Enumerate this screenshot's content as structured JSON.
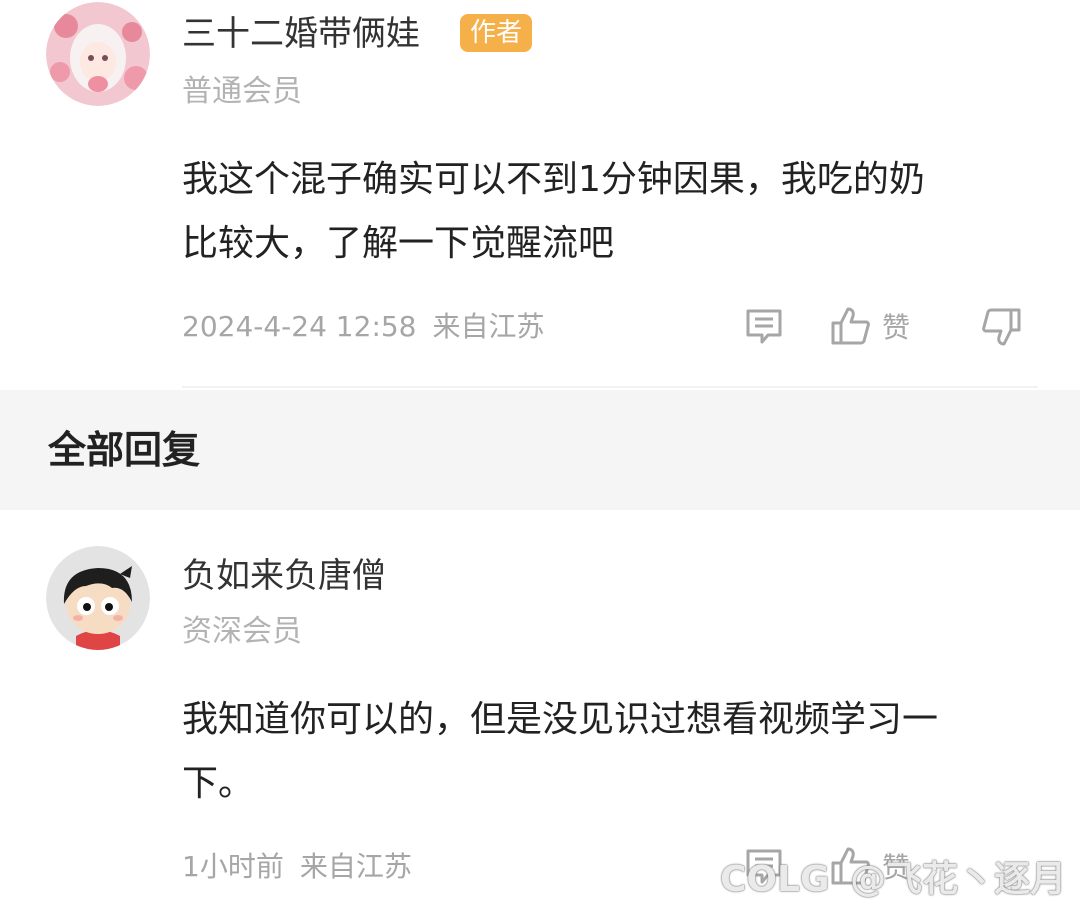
{
  "post": {
    "username": "三十二婚带俩娃",
    "badge": "作者",
    "member_level": "普通会员",
    "content_line1": "我这个混子确实可以不到1分钟因果，我吃的奶",
    "content_line2": "比较大，了解一下觉醒流吧",
    "timestamp": "2024-4-24 12:58",
    "location": "来自江苏",
    "like_label": "赞"
  },
  "section": {
    "title": "全部回复"
  },
  "reply": {
    "username": "负如来负唐僧",
    "member_level": "资深会员",
    "content_line1": "我知道你可以的，但是没见识过想看视频学习一",
    "content_line2": "下。",
    "timestamp": "1小时前",
    "location": "来自江苏",
    "like_label": "赞"
  },
  "watermark": {
    "logo": "COLG",
    "text": "@飞花丶逐月"
  },
  "colors": {
    "badge": "#f5b04a",
    "muted": "#a6a6a6",
    "section_bg": "#f5f5f5"
  },
  "icons": [
    "comment-icon",
    "thumbs-up-icon",
    "thumbs-down-icon"
  ]
}
